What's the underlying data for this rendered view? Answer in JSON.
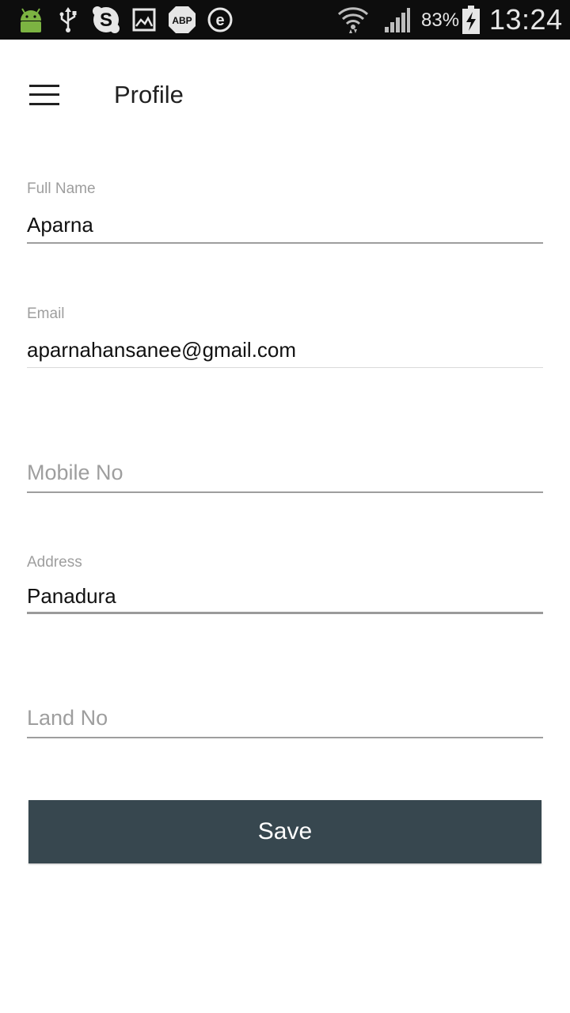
{
  "status_bar": {
    "icons": [
      "android-icon",
      "usb-icon",
      "skype-icon",
      "gallery-icon",
      "adblock-icon",
      "ebuddy-icon",
      "wifi-icon",
      "signal-icon",
      "battery-charging-icon"
    ],
    "battery_percent": "83%",
    "time": "13:24"
  },
  "app_bar": {
    "menu_icon": "hamburger-menu-icon",
    "title": "Profile"
  },
  "form": {
    "full_name": {
      "label": "Full Name",
      "value": "Aparna"
    },
    "email": {
      "label": "Email",
      "value": "aparnahansanee@gmail.com"
    },
    "mobile": {
      "placeholder": "Mobile No"
    },
    "address": {
      "label": "Address",
      "value": "Panadura"
    },
    "land": {
      "placeholder": "Land No"
    }
  },
  "save_button": {
    "label": "Save"
  },
  "colors": {
    "button_bg": "#37474f",
    "status_bar_bg": "#0d0d0d",
    "label_gray": "#9e9e9e"
  }
}
